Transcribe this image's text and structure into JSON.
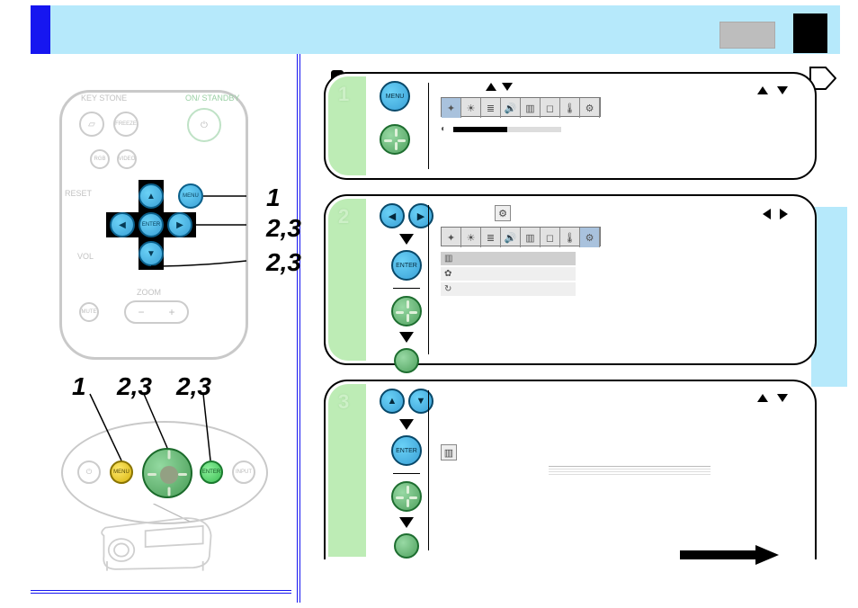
{
  "remote": {
    "labels": {
      "keystone": "KEY\nSTONE",
      "onstandby": "ON/\nSTANDBY",
      "freeze": "FREEZE",
      "rgb": "RGB",
      "video": "VIDEO",
      "reset": "RESET",
      "menu": "MENU",
      "enter": "ENTER",
      "vol": "VOL",
      "mute": "MUTE",
      "zoom": "ZOOM",
      "minus": "−",
      "plus": "+"
    },
    "callouts": {
      "a": "1",
      "b": "2,3",
      "c": "2,3"
    }
  },
  "panel": {
    "callouts": {
      "a": "1",
      "b": "2,3",
      "c": "2,3"
    },
    "buttons": {
      "power": "⏻",
      "menu": "MENU",
      "enter": "ENTER",
      "input": "INPUT"
    }
  },
  "steps": {
    "s1": {
      "num": "1",
      "indicators": "▲ ▼",
      "icons": [
        "✦",
        "☀",
        "≣",
        "🔊",
        "▥",
        "◻",
        "🌡",
        "⚙"
      ],
      "slider_label": "◐"
    },
    "s2": {
      "num": "2",
      "tab_icon": "⚙",
      "indicators_l": "◀",
      "indicators_r": "▶",
      "icons": [
        "✦",
        "☀",
        "≣",
        "🔊",
        "▥",
        "◻",
        "🌡",
        "⚙"
      ],
      "list": [
        {
          "icon": "▥",
          "label": ""
        },
        {
          "icon": "✿",
          "label": ""
        },
        {
          "icon": "↻",
          "label": ""
        }
      ]
    },
    "s3": {
      "num": "3",
      "indicators": "▲ ▼",
      "row_icon": "▥",
      "options": [
        {
          "k": "",
          "v": ""
        },
        {
          "k": "",
          "v": ""
        },
        {
          "k": "",
          "v": ""
        },
        {
          "k": "",
          "v": ""
        }
      ]
    }
  }
}
